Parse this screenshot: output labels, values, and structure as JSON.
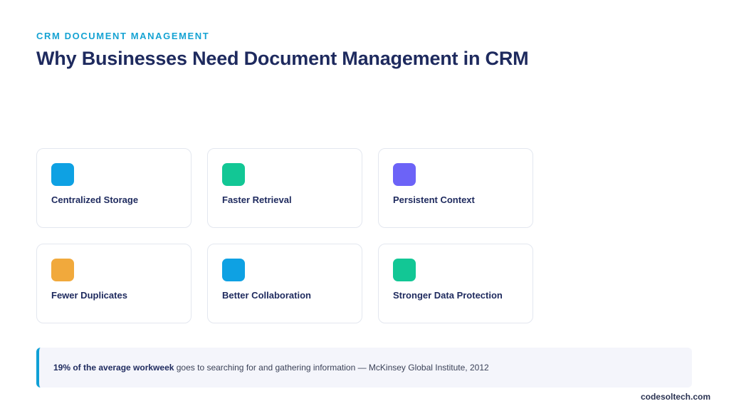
{
  "header": {
    "eyebrow": "CRM DOCUMENT MANAGEMENT",
    "title": "Why Businesses Need Document Management in CRM"
  },
  "cards": [
    {
      "label": "Centralized Storage",
      "color": "#0ea1e3"
    },
    {
      "label": "Faster Retrieval",
      "color": "#12c795"
    },
    {
      "label": "Persistent Context",
      "color": "#6c63f7"
    },
    {
      "label": "Fewer Duplicates",
      "color": "#f1a93c"
    },
    {
      "label": "Better Collaboration",
      "color": "#0ea1e3"
    },
    {
      "label": "Stronger Data Protection",
      "color": "#12c795"
    }
  ],
  "callout": {
    "highlight": "19% of the average workweek",
    "rest": " goes to searching for and gathering information — McKinsey Global Institute, 2012",
    "accent": "#0fa0d6"
  },
  "footer": {
    "brand": "codesoltech.com"
  }
}
